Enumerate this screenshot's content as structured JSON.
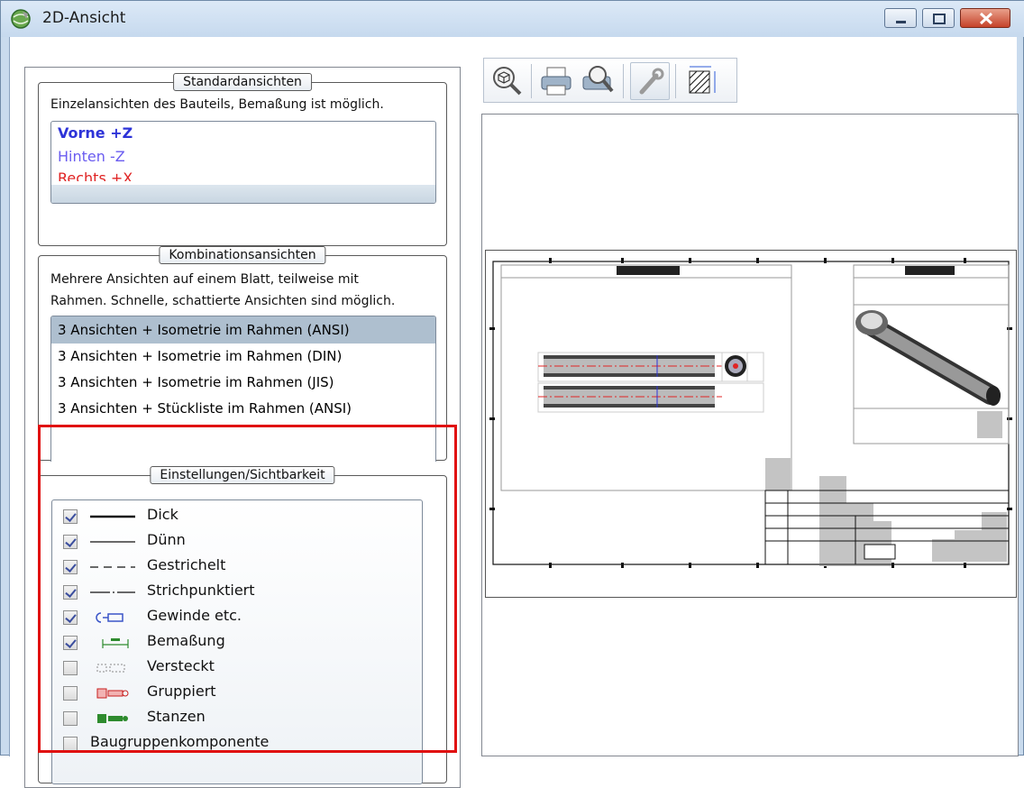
{
  "window": {
    "title": "2D-Ansicht",
    "icon": "app-globe-icon",
    "accent_close": "#c5432a"
  },
  "standard_views": {
    "legend": "Standardansichten",
    "description": "Einzelansichten des Bauteils, Bemaßung ist möglich.",
    "items": [
      {
        "label": "Vorne +Z",
        "color": "#2d33d8"
      },
      {
        "label": "Hinten -Z",
        "color": "#6a5cf0"
      },
      {
        "label": "Rechts +X",
        "color": "#e02424"
      }
    ]
  },
  "combination_views": {
    "legend": "Kombinationsansichten",
    "description_line1": "Mehrere Ansichten auf einem Blatt, teilweise mit",
    "description_line2": "Rahmen. Schnelle, schattierte Ansichten sind möglich.",
    "items": [
      {
        "label": "3 Ansichten + Isometrie im Rahmen (ANSI)",
        "selected": true
      },
      {
        "label": "3 Ansichten + Isometrie im Rahmen (DIN)",
        "selected": false
      },
      {
        "label": "3 Ansichten + Isometrie im Rahmen (JIS)",
        "selected": false
      },
      {
        "label": "3 Ansichten + Stückliste im Rahmen (ANSI)",
        "selected": false
      }
    ]
  },
  "settings": {
    "legend": "Einstellungen/Sichtbarkeit",
    "items": [
      {
        "label": "Dick",
        "checked": true,
        "icon": "thick-line-icon"
      },
      {
        "label": "Dünn",
        "checked": true,
        "icon": "thin-line-icon"
      },
      {
        "label": "Gestrichelt",
        "checked": true,
        "icon": "dashed-line-icon"
      },
      {
        "label": "Strichpunktiert",
        "checked": true,
        "icon": "dash-dot-line-icon"
      },
      {
        "label": "Gewinde etc.",
        "checked": true,
        "icon": "thread-icon"
      },
      {
        "label": "Bemaßung",
        "checked": true,
        "icon": "dimension-icon"
      },
      {
        "label": "Versteckt",
        "checked": false,
        "icon": "hidden-icon"
      },
      {
        "label": "Gruppiert",
        "checked": false,
        "icon": "grouped-icon"
      },
      {
        "label": "Stanzen",
        "checked": false,
        "icon": "punch-icon"
      },
      {
        "label": "Baugruppenkomponente",
        "checked": false,
        "icon": ""
      }
    ],
    "highlight_color": "#e01010"
  },
  "toolbar": {
    "buttons": [
      {
        "icon": "zoom-view-icon",
        "active": false
      },
      {
        "icon": "print-icon",
        "active": false
      },
      {
        "icon": "print-preview-icon",
        "active": false
      },
      {
        "icon": "wrench-icon",
        "active": true
      },
      {
        "icon": "section-dimension-icon",
        "active": false
      }
    ]
  }
}
